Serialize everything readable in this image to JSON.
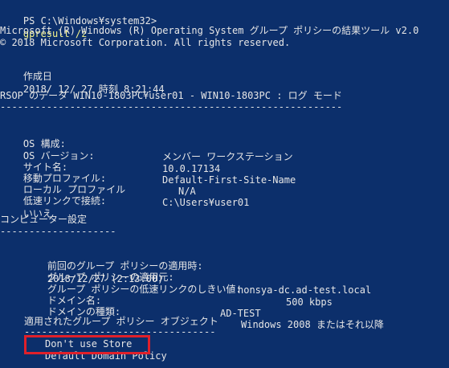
{
  "prompt": {
    "path": "PS C:\\Windows¥system32>",
    "command": "gpresult /z"
  },
  "header": {
    "product_line": "Microsoft (R) Windows (R) Operating System グループ ポリシーの結果ツール v2.0",
    "copyright_line": "© 2018 Microsoft Corporation. All rights reserved."
  },
  "created": {
    "label": "作成日",
    "value": "2018/ 12/ 27 時刻 8:21:44"
  },
  "rsop": {
    "title": "RSOP のデータ WIN10-1803PC¥user01 - WIN10-1803PC : ログ モード",
    "separator": "-----------------------------------------------------------"
  },
  "os_info": [
    {
      "label": "OS 構成:",
      "value": "メンバー ワークステーション"
    },
    {
      "label": "OS バージョン:",
      "value": "10.0.17134"
    },
    {
      "label": "サイト名:",
      "value": "Default-First-Site-Name"
    },
    {
      "label": "移動プロファイル:",
      "value": "N/A"
    },
    {
      "label": "ローカル プロファイル",
      "value": "C:\\Users¥user01"
    }
  ],
  "slow_link": {
    "label": "低速リンクで接続:",
    "value": "いいえ"
  },
  "computer_settings": {
    "title": "コンピューター設定",
    "underline": "--------------------"
  },
  "policy_info": [
    {
      "label": "前回のグループ ポリシーの適用時:",
      "value": "2018/12/27 (2:13:00)"
    },
    {
      "label": "グループ ポリシーの適用元:",
      "value": "honsya-dc.ad-test.local"
    },
    {
      "label": "グループ ポリシーの低速リンクのしきい値:",
      "value": "500 kbps"
    },
    {
      "label": "ドメイン名:",
      "value": "AD-TEST"
    },
    {
      "label": "ドメインの種類:",
      "value": "Windows 2008 またはそれ以降"
    }
  ],
  "applied_gpos": {
    "title": "適用されたグループ ポリシー オブジェクト",
    "underline": "---------------------------------",
    "items": [
      "Don't use Store",
      "Default Domain Policy"
    ]
  },
  "colors": {
    "background": "#0c2f6b",
    "text": "#e6e6e6",
    "command": "#f3f38a",
    "highlight_border": "#e0202a"
  }
}
